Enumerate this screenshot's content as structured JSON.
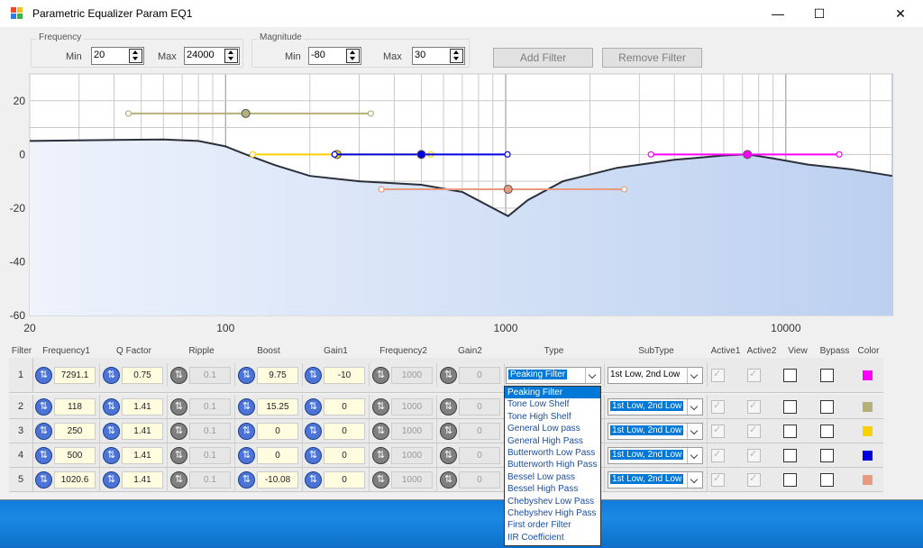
{
  "window": {
    "title": "Parametric Equalizer Param EQ1"
  },
  "frequency": {
    "label": "Frequency",
    "min_label": "Min",
    "min": "20",
    "max_label": "Max",
    "max": "24000"
  },
  "magnitude": {
    "label": "Magnitude",
    "min_label": "Min",
    "min": "-80",
    "max_label": "Max",
    "max": "30"
  },
  "buttons": {
    "add": "Add Filter",
    "remove": "Remove Filter"
  },
  "chart_data": {
    "type": "line",
    "x_scale": "log",
    "xlim": [
      20,
      24000
    ],
    "ylim": [
      -60,
      30
    ],
    "xtick_labels": [
      "20",
      "100",
      "1000",
      "10000"
    ],
    "ytick_labels": [
      "20",
      "0",
      "-20",
      "-40",
      "-60"
    ],
    "grid": true,
    "response_curve": {
      "x": [
        20,
        40,
        60,
        80,
        100,
        118,
        150,
        200,
        300,
        500,
        700,
        900,
        1020,
        1200,
        1600,
        2500,
        4000,
        6000,
        7291,
        9000,
        12000,
        17000,
        24000
      ],
      "y": [
        5,
        5.4,
        5.6,
        5,
        3,
        0,
        -4,
        -8,
        -10,
        -11.3,
        -14,
        -20,
        -23,
        -17,
        -10,
        -5,
        -2,
        -0.4,
        0,
        -1.5,
        -3.8,
        -5.5,
        -8
      ]
    },
    "filter_markers": [
      {
        "freq": 118,
        "gain": 15.25,
        "lo": 45,
        "hi": 330,
        "color": "#b5b07a"
      },
      {
        "freq": 250,
        "gain": 0,
        "lo": 125,
        "hi": 540,
        "color": "#ffd000"
      },
      {
        "freq": 500,
        "gain": 0,
        "lo": 245,
        "hi": 1015,
        "color": "#0000e0"
      },
      {
        "freq": 1020.6,
        "gain": -13,
        "lo": 360,
        "hi": 2650,
        "color": "#e89a7e"
      },
      {
        "freq": 7291.1,
        "gain": 0,
        "lo": 3300,
        "hi": 15500,
        "color": "#ff00ff"
      }
    ]
  },
  "grid": {
    "headers": [
      "Filter",
      "Frequency1",
      "Q Factor",
      "Ripple",
      "Boost",
      "Gain1",
      "Frequency2",
      "Gain2",
      "Type",
      "SubType",
      "Active1",
      "Active2",
      "View",
      "Bypass",
      "Color"
    ],
    "rows": [
      {
        "num": "1",
        "freq1": "7291.1",
        "q": "0.75",
        "ripple": "0.1",
        "boost": "9.75",
        "gain1": "-10",
        "freq2": "1000",
        "gain2": "0",
        "type": "Peaking Filter",
        "subtype": "1st Low, 2nd Low",
        "color": "#ff00ff"
      },
      {
        "num": "2",
        "freq1": "118",
        "q": "1.41",
        "ripple": "0.1",
        "boost": "15.25",
        "gain1": "0",
        "freq2": "1000",
        "gain2": "0",
        "type": "",
        "subtype": "1st Low, 2nd Low",
        "color": "#b5b07a"
      },
      {
        "num": "3",
        "freq1": "250",
        "q": "1.41",
        "ripple": "0.1",
        "boost": "0",
        "gain1": "0",
        "freq2": "1000",
        "gain2": "0",
        "type": "",
        "subtype": "1st Low, 2nd Low",
        "color": "#ffd000"
      },
      {
        "num": "4",
        "freq1": "500",
        "q": "1.41",
        "ripple": "0.1",
        "boost": "0",
        "gain1": "0",
        "freq2": "1000",
        "gain2": "0",
        "type": "",
        "subtype": "1st Low, 2nd Low",
        "color": "#0000e0"
      },
      {
        "num": "5",
        "freq1": "1020.6",
        "q": "1.41",
        "ripple": "0.1",
        "boost": "-10.08",
        "gain1": "0",
        "freq2": "1000",
        "gain2": "0",
        "type": "",
        "subtype": "1st Low, 2nd Low",
        "color": "#e89a7e"
      }
    ]
  },
  "type_dropdown": {
    "options": [
      "Peaking Filter",
      "Tone Low Shelf",
      "Tone High Shelf",
      "General Low pass",
      "General High Pass",
      "Butterworth Low Pass",
      "Butterworth High Pass",
      "Bessel Low pass",
      "Bessel High Pass",
      "Chebyshev Low Pass",
      "Chebyshev High Pass",
      "First order Filter",
      "IIR Coefficient"
    ],
    "selected": 0
  }
}
